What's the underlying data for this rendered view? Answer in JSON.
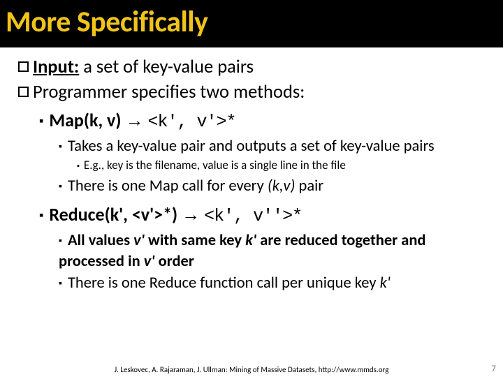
{
  "title": "More Specifically",
  "l1a_label": "Input:",
  "l1a_text": " a set of key-value pairs",
  "l1b_text": "Programmer specifies two methods:",
  "map_sig": "Map(k, v)",
  "map_rhs": "<k', v'>*",
  "map_p1": "Takes a key-value pair and outputs a set of key-value pairs",
  "map_eg": "E.g., key is the filename, value is a single line in the file",
  "map_p2a": "There is one Map call for every ",
  "map_p2b": "(k,v)",
  "map_p2c": " pair",
  "red_sig": "Reduce(k', <v'>*)",
  "red_rhs": "<k', v''>*",
  "red_p1a": "All values ",
  "red_p1b": "v'",
  "red_p1c": " with same key ",
  "red_p1d": "k'",
  "red_p1e": " are reduced together and processed in ",
  "red_p1f": "v'",
  "red_p1g": " order",
  "red_p2a": "There is one Reduce function call per unique key ",
  "red_p2b": "k'",
  "footer": "J. Leskovec, A. Rajaraman, J. Ullman: Mining of Massive Datasets, http://www.mmds.org",
  "page": "7",
  "arrow": "→"
}
